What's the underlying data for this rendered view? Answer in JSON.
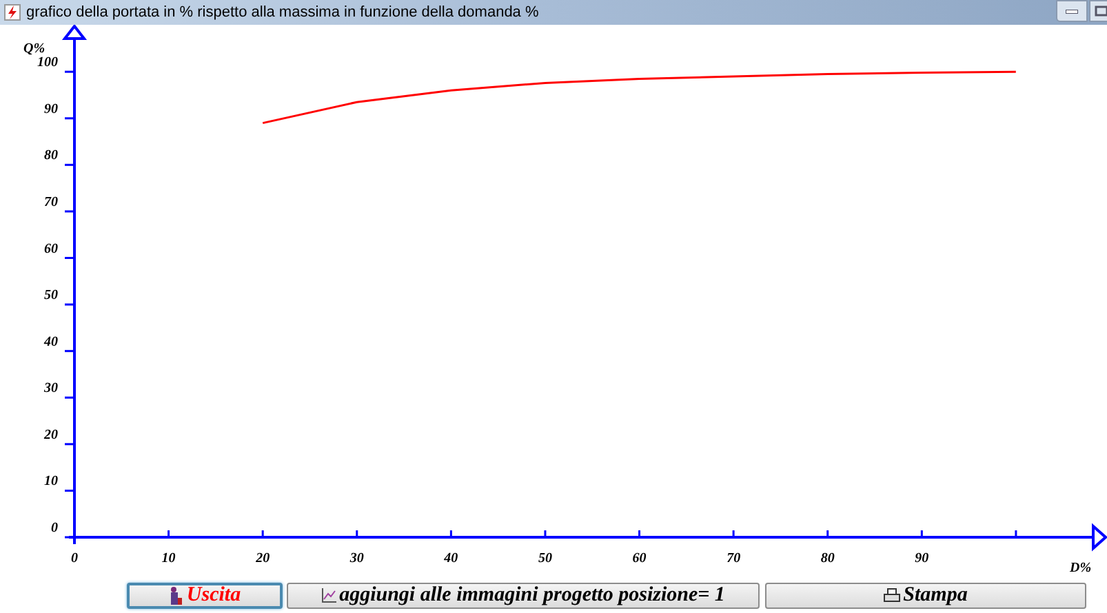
{
  "window": {
    "title": "grafico della portata in % rispetto alla massima in funzione della domanda %"
  },
  "chart": {
    "chart_data": {
      "type": "line",
      "xlabel": "D%",
      "ylabel": "Q%",
      "x": [
        20,
        30,
        40,
        50,
        60,
        70,
        80,
        90,
        100
      ],
      "series": [
        {
          "color": "#ff0000",
          "values": [
            89,
            93.5,
            96,
            97.6,
            98.5,
            99,
            99.5,
            99.8,
            100
          ]
        }
      ],
      "xlim": [
        0,
        108.5
      ],
      "ylim": [
        0,
        109.5
      ],
      "xticks": [
        0,
        10,
        20,
        30,
        40,
        50,
        60,
        70,
        80,
        90
      ],
      "yticks": [
        0,
        10,
        20,
        30,
        40,
        50,
        60,
        70,
        80,
        90,
        100
      ]
    }
  },
  "buttons": [
    {
      "label": "Uscita",
      "kind": "exit",
      "focused": true
    },
    {
      "label": "aggiungi alle immagini progetto posizione= 1",
      "kind": "add",
      "focused": false
    },
    {
      "label": "Stampa",
      "kind": "print",
      "focused": false
    }
  ]
}
